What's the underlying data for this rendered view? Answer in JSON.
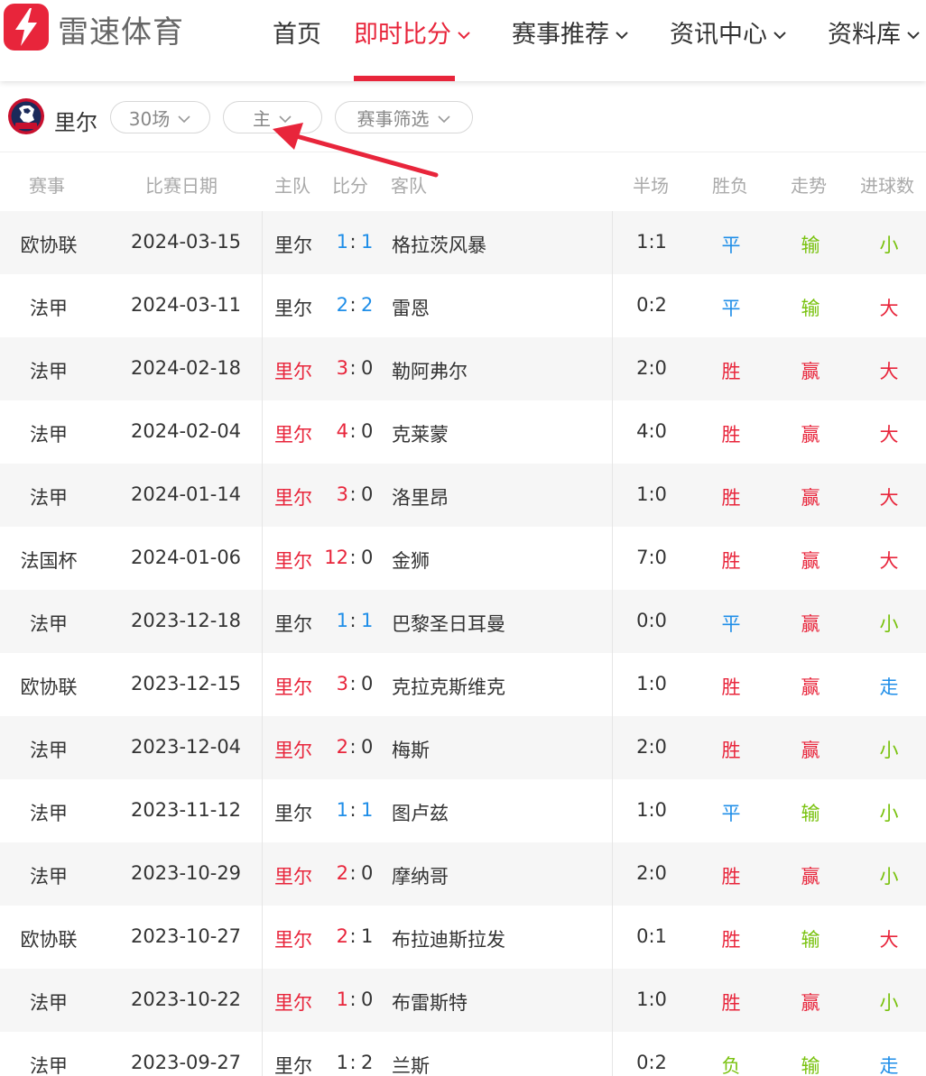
{
  "header": {
    "brand": "雷速体育",
    "nav": [
      {
        "label": "首页",
        "active": false,
        "dropdown": false
      },
      {
        "label": "即时比分",
        "active": true,
        "dropdown": true
      },
      {
        "label": "赛事推荐",
        "active": false,
        "dropdown": true
      },
      {
        "label": "资讯中心",
        "active": false,
        "dropdown": true
      },
      {
        "label": "资料库",
        "active": false,
        "dropdown": true
      }
    ]
  },
  "filters": {
    "team_name": "里尔",
    "count_label": "30场",
    "home_label": "主",
    "league_label": "赛事筛选"
  },
  "table": {
    "headers": {
      "league": "赛事",
      "date": "比赛日期",
      "home": "主队",
      "score": "比分",
      "away": "客队",
      "half": "半场",
      "result": "胜负",
      "trend": "走势",
      "goals": "进球数"
    },
    "rows": [
      {
        "league": "欧协联",
        "date": "2024-03-15",
        "home": "里尔",
        "hs": "1",
        "as": "1",
        "away": "格拉茨风暴",
        "half": "1:1",
        "result": "平",
        "trend": "输",
        "goals": "小"
      },
      {
        "league": "法甲",
        "date": "2024-03-11",
        "home": "里尔",
        "hs": "2",
        "as": "2",
        "away": "雷恩",
        "half": "0:2",
        "result": "平",
        "trend": "输",
        "goals": "大"
      },
      {
        "league": "法甲",
        "date": "2024-02-18",
        "home": "里尔",
        "hs": "3",
        "as": "0",
        "away": "勒阿弗尔",
        "half": "2:0",
        "result": "胜",
        "trend": "赢",
        "goals": "大"
      },
      {
        "league": "法甲",
        "date": "2024-02-04",
        "home": "里尔",
        "hs": "4",
        "as": "0",
        "away": "克莱蒙",
        "half": "4:0",
        "result": "胜",
        "trend": "赢",
        "goals": "大"
      },
      {
        "league": "法甲",
        "date": "2024-01-14",
        "home": "里尔",
        "hs": "3",
        "as": "0",
        "away": "洛里昂",
        "half": "1:0",
        "result": "胜",
        "trend": "赢",
        "goals": "大"
      },
      {
        "league": "法国杯",
        "date": "2024-01-06",
        "home": "里尔",
        "hs": "12",
        "as": "0",
        "away": "金狮",
        "half": "7:0",
        "result": "胜",
        "trend": "赢",
        "goals": "大"
      },
      {
        "league": "法甲",
        "date": "2023-12-18",
        "home": "里尔",
        "hs": "1",
        "as": "1",
        "away": "巴黎圣日耳曼",
        "half": "0:0",
        "result": "平",
        "trend": "赢",
        "goals": "小"
      },
      {
        "league": "欧协联",
        "date": "2023-12-15",
        "home": "里尔",
        "hs": "3",
        "as": "0",
        "away": "克拉克斯维克",
        "half": "1:0",
        "result": "胜",
        "trend": "赢",
        "goals": "走"
      },
      {
        "league": "法甲",
        "date": "2023-12-04",
        "home": "里尔",
        "hs": "2",
        "as": "0",
        "away": "梅斯",
        "half": "2:0",
        "result": "胜",
        "trend": "赢",
        "goals": "小"
      },
      {
        "league": "法甲",
        "date": "2023-11-12",
        "home": "里尔",
        "hs": "1",
        "as": "1",
        "away": "图卢兹",
        "half": "1:0",
        "result": "平",
        "trend": "输",
        "goals": "小"
      },
      {
        "league": "法甲",
        "date": "2023-10-29",
        "home": "里尔",
        "hs": "2",
        "as": "0",
        "away": "摩纳哥",
        "half": "2:0",
        "result": "胜",
        "trend": "赢",
        "goals": "小"
      },
      {
        "league": "欧协联",
        "date": "2023-10-27",
        "home": "里尔",
        "hs": "2",
        "as": "1",
        "away": "布拉迪斯拉发",
        "half": "0:1",
        "result": "胜",
        "trend": "输",
        "goals": "大"
      },
      {
        "league": "法甲",
        "date": "2023-10-22",
        "home": "里尔",
        "hs": "1",
        "as": "0",
        "away": "布雷斯特",
        "half": "1:0",
        "result": "胜",
        "trend": "赢",
        "goals": "小"
      },
      {
        "league": "法甲",
        "date": "2023-09-27",
        "home": "里尔",
        "hs": "1",
        "as": "2",
        "away": "兰斯",
        "half": "0:2",
        "result": "负",
        "trend": "输",
        "goals": "走"
      }
    ]
  },
  "colors": {
    "accent": "#e8253b",
    "draw": "#1f8ee8",
    "good": "#79c20e",
    "text": "#333333"
  }
}
